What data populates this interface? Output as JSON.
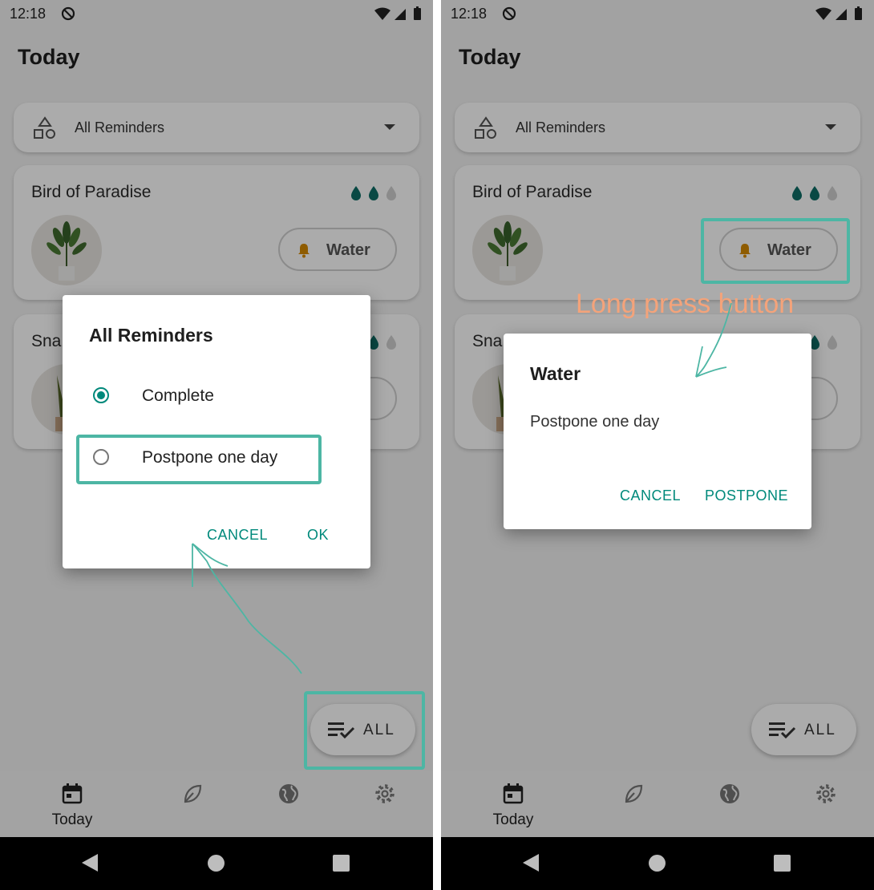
{
  "status_time": "12:18",
  "page_title": "Today",
  "filter_label": "All Reminders",
  "plants": [
    {
      "name": "Bird of Paradise",
      "action_label": "Water"
    },
    {
      "name": "Sna"
    }
  ],
  "fab_label": "ALL",
  "bottom_nav": [
    {
      "label": "Today",
      "icon": "calendar-icon"
    },
    {
      "icon": "leaf-icon"
    },
    {
      "icon": "globe-icon"
    },
    {
      "icon": "gear-icon"
    }
  ],
  "dialog_left": {
    "title": "All Reminders",
    "options": [
      "Complete",
      "Postpone one day"
    ],
    "selected_index": 0,
    "cancel_label": "CANCEL",
    "ok_label": "OK"
  },
  "dialog_right": {
    "title": "Water",
    "message": "Postpone one day",
    "cancel_label": "CANCEL",
    "confirm_label": "POSTPONE"
  },
  "annotation_text": "Long press button",
  "colors": {
    "accent": "#00897b",
    "highlight": "#4db6a4",
    "annotation": "#f4a37a",
    "bell": "#d58a00"
  }
}
